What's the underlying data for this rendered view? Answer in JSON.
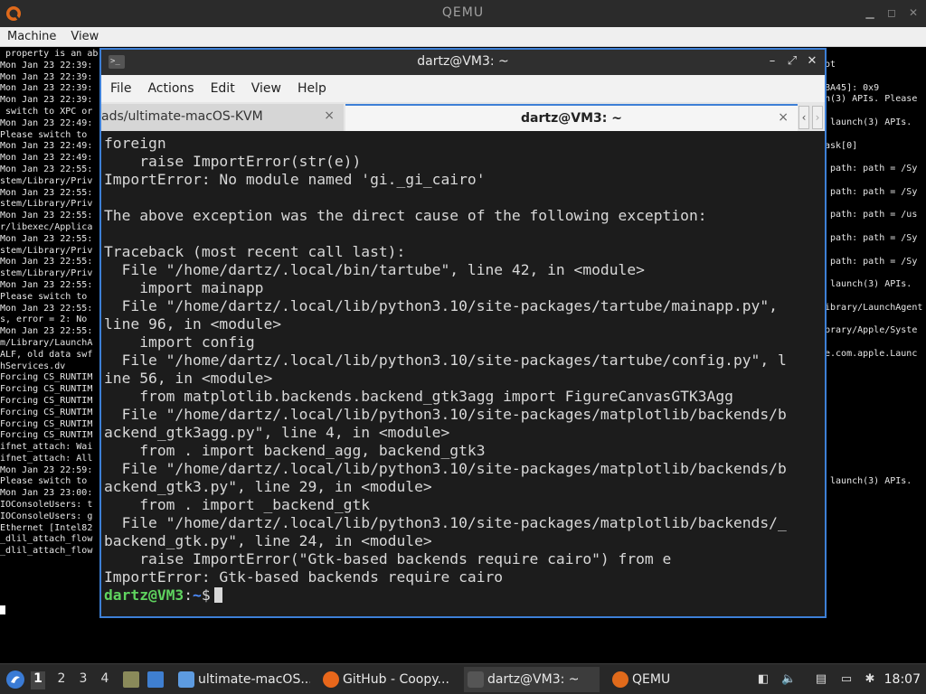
{
  "qemu": {
    "title": "QEMU",
    "menu": [
      "Machine",
      "View"
    ]
  },
  "console": {
    "left_lines": [
      " property is an ab",
      "Mon Jan 23 22:39:",
      "Mon Jan 23 22:39:",
      "Mon Jan 23 22:39:",
      "Mon Jan 23 22:39:",
      " switch to XPC or",
      "Mon Jan 23 22:49:",
      "Please switch to",
      "Mon Jan 23 22:49:",
      "Mon Jan 23 22:49:",
      "Mon Jan 23 22:55:",
      "stem/Library/Priv",
      "Mon Jan 23 22:55:",
      "stem/Library/Priv",
      "Mon Jan 23 22:55:",
      "r/libexec/Applica",
      "Mon Jan 23 22:55:",
      "stem/Library/Priv",
      "Mon Jan 23 22:55:",
      "stem/Library/Priv",
      "Mon Jan 23 22:55:",
      "Please switch to",
      "Mon Jan 23 22:55:",
      "s, error = 2: No",
      "Mon Jan 23 22:55:",
      "m/Library/LaunchA",
      "ALF, old data swf",
      "hServices.dv",
      "Forcing CS_RUNTIM",
      "Forcing CS_RUNTIM",
      "Forcing CS_RUNTIM",
      "Forcing CS_RUNTIM",
      "Forcing CS_RUNTIM",
      "Forcing CS_RUNTIM",
      "ifnet_attach: Wai",
      "ifnet_attach: All",
      "Mon Jan 23 22:59:",
      "Please switch to",
      "Mon Jan 23 23:00:",
      "IOConsoleUsers: t",
      "IOConsoleUsers: g",
      "Ethernet [Intel82",
      "_dlil_attach_flow",
      "_dlil_attach_flow"
    ],
    "right_lines": [
      "ot",
      "",
      "BA45]: 0x9",
      "h(3) APIs. Please",
      "",
      " launch(3) APIs.",
      "",
      "ask[0]",
      "",
      " path: path = /Sy",
      "",
      " path: path = /Sy",
      "",
      " path: path = /us",
      "",
      " path: path = /Sy",
      "",
      " path: path = /Sy",
      "",
      " launch(3) APIs.",
      "",
      "ibrary/LaunchAgent",
      "",
      "brary/Apple/Syste",
      "",
      "e.com.apple.Launc",
      "",
      "",
      "",
      "",
      "",
      "",
      "",
      "",
      "",
      "",
      " launch(3) APIs."
    ]
  },
  "terminal": {
    "title": "dartz@VM3: ~",
    "menu": [
      "File",
      "Actions",
      "Edit",
      "View",
      "Help"
    ],
    "tabs": [
      {
        "label": "ads/ultimate-macOS-KVM",
        "close": "×"
      },
      {
        "label": "dartz@VM3: ~",
        "close": "×"
      }
    ],
    "output": "foreign\n    raise ImportError(str(e))\nImportError: No module named 'gi._gi_cairo'\n\nThe above exception was the direct cause of the following exception:\n\nTraceback (most recent call last):\n  File \"/home/dartz/.local/bin/tartube\", line 42, in <module>\n    import mainapp\n  File \"/home/dartz/.local/lib/python3.10/site-packages/tartube/mainapp.py\",\nline 96, in <module>\n    import config\n  File \"/home/dartz/.local/lib/python3.10/site-packages/tartube/config.py\", l\nine 56, in <module>\n    from matplotlib.backends.backend_gtk3agg import FigureCanvasGTK3Agg\n  File \"/home/dartz/.local/lib/python3.10/site-packages/matplotlib/backends/b\nackend_gtk3agg.py\", line 4, in <module>\n    from . import backend_agg, backend_gtk3\n  File \"/home/dartz/.local/lib/python3.10/site-packages/matplotlib/backends/b\nackend_gtk3.py\", line 29, in <module>\n    from . import _backend_gtk\n  File \"/home/dartz/.local/lib/python3.10/site-packages/matplotlib/backends/_\nbackend_gtk.py\", line 24, in <module>\n    raise ImportError(\"Gtk-based backends require cairo\") from e\nImportError: Gtk-based backends require cairo",
    "prompt": {
      "user": "dartz@VM3",
      "sep": ":",
      "path": "~",
      "symbol": "$"
    }
  },
  "taskbar": {
    "workspaces": [
      "1",
      "2",
      "3",
      "4"
    ],
    "tasks": [
      {
        "label": "ultimate-macOS...",
        "icon": "folder-icon"
      },
      {
        "label": "GitHub - Coopy...",
        "icon": "firefox-icon"
      },
      {
        "label": "dartz@VM3: ~",
        "icon": "terminal-icon"
      },
      {
        "label": "QEMU",
        "icon": "qemu-icon"
      }
    ],
    "clock": "18:07"
  }
}
